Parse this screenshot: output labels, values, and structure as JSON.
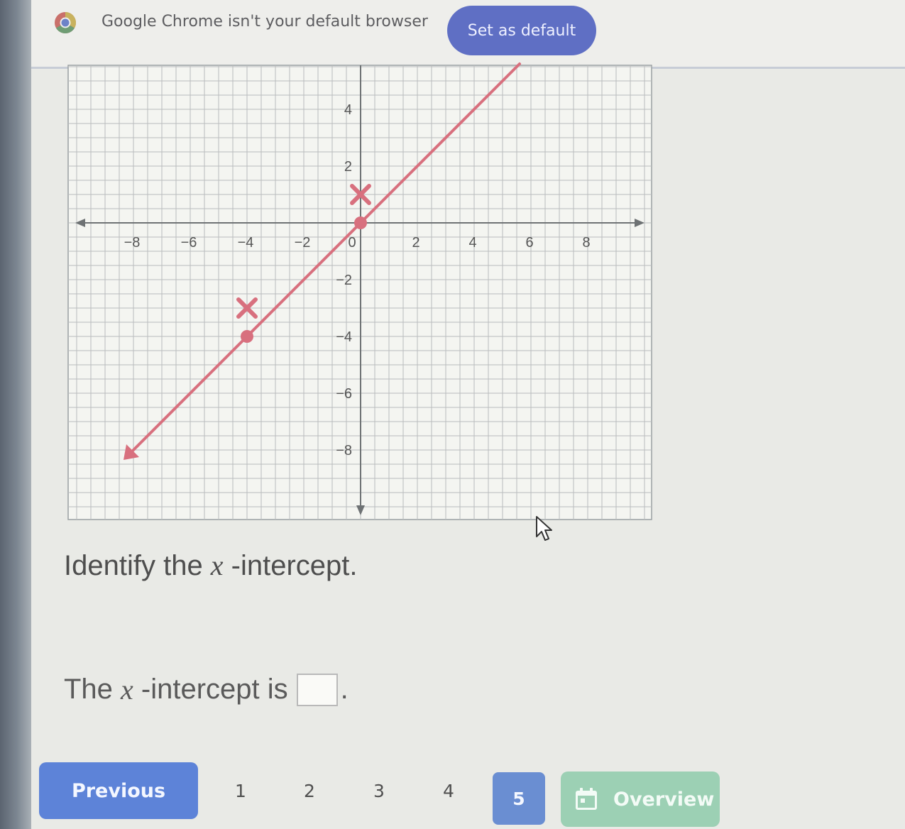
{
  "infobar": {
    "message": "Google Chrome isn't your default browser",
    "button_label": "Set as default",
    "icon": "chrome-icon"
  },
  "graph": {
    "x_ticks": [
      "−8",
      "−6",
      "−4",
      "−2",
      "0",
      "2",
      "4",
      "6",
      "8"
    ],
    "y_ticks": [
      "4",
      "2",
      "−2",
      "−4",
      "−6",
      "−8"
    ],
    "line_color": "#d8707e",
    "point_color": "#d8707e",
    "plotted_points": [
      {
        "x": -4,
        "y": -4
      },
      {
        "x": 0,
        "y": 0
      }
    ],
    "x_marks": [
      {
        "x": -4,
        "y": -3
      },
      {
        "x": 0,
        "y": 1
      }
    ]
  },
  "question": {
    "prefix": "Identify the ",
    "var": "x",
    "suffix": " -intercept."
  },
  "answer": {
    "prefix": "The ",
    "var": "x",
    "suffix": " -intercept is",
    "value": "",
    "period": "."
  },
  "nav": {
    "previous_label": "Previous",
    "pages": [
      "1",
      "2",
      "3",
      "4",
      "5"
    ],
    "current_page": "5",
    "overview_label": "Overview",
    "overview_icon": "calendar-icon"
  },
  "colors": {
    "primary_button": "#5d83d8",
    "overview_button": "#9cd0b4",
    "infobar_button": "#5f6fc4"
  }
}
